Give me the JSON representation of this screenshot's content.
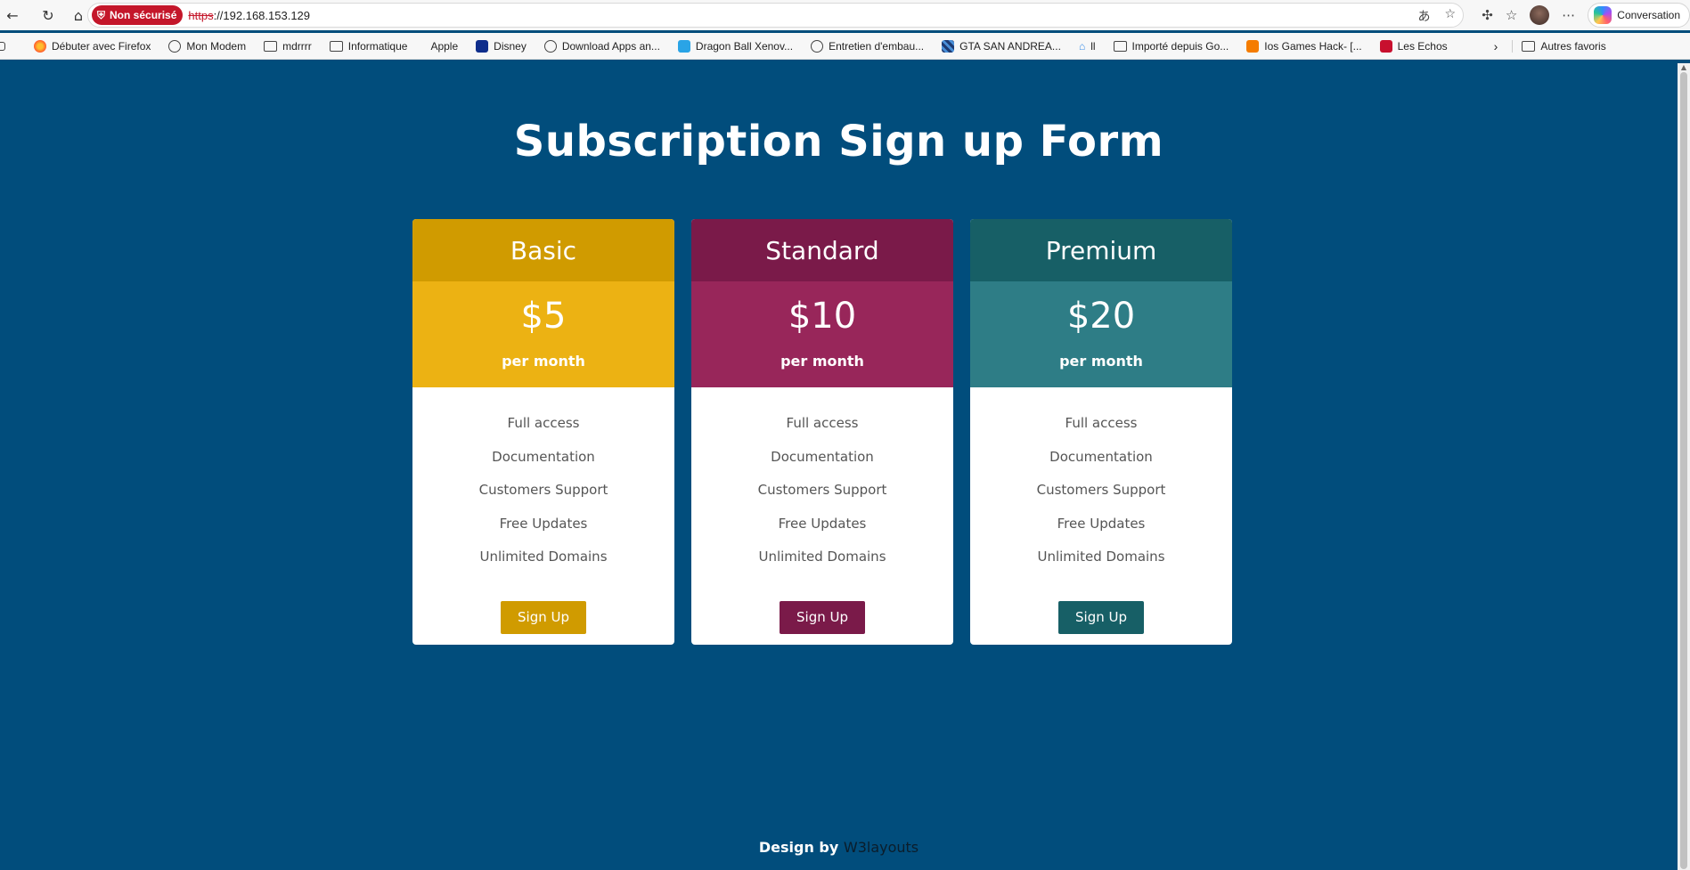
{
  "browser": {
    "security_label": "Non sécurisé",
    "url_scheme": "https",
    "url_rest": "://192.168.153.129",
    "conversation_label": "Conversation",
    "bookmarks": [
      {
        "label": "Débuter avec Firefox",
        "icon": "firefox-icon"
      },
      {
        "label": "Mon Modem",
        "icon": "globe-icon"
      },
      {
        "label": "mdrrrr",
        "icon": "folder-icon"
      },
      {
        "label": "Informatique",
        "icon": "folder-icon"
      },
      {
        "label": "Apple",
        "icon": "apple-icon"
      },
      {
        "label": "Disney",
        "icon": "disney-icon"
      },
      {
        "label": "Download Apps an...",
        "icon": "globe-icon"
      },
      {
        "label": "Dragon Ball Xenov...",
        "icon": "store-icon"
      },
      {
        "label": "Entretien d'embau...",
        "icon": "globe-icon"
      },
      {
        "label": "GTA SAN ANDREA...",
        "icon": "gta-icon"
      },
      {
        "label": "ll",
        "icon": "bookmark-icon"
      },
      {
        "label": "Importé depuis Go...",
        "icon": "folder-icon"
      },
      {
        "label": "Ios Games Hack- [...",
        "icon": "blogger-icon"
      },
      {
        "label": "Les Echos",
        "icon": "echos-icon"
      }
    ],
    "other_favorites": "Autres favoris"
  },
  "page": {
    "title": "Subscription Sign up Form",
    "plans": [
      {
        "name": "Basic",
        "price": "$5",
        "period": "per month",
        "features": [
          "Full access",
          "Documentation",
          "Customers Support",
          "Free Updates",
          "Unlimited Domains"
        ],
        "button": "Sign Up"
      },
      {
        "name": "Standard",
        "price": "$10",
        "period": "per month",
        "features": [
          "Full access",
          "Documentation",
          "Customers Support",
          "Free Updates",
          "Unlimited Domains"
        ],
        "button": "Sign Up"
      },
      {
        "name": "Premium",
        "price": "$20",
        "period": "per month",
        "features": [
          "Full access",
          "Documentation",
          "Customers Support",
          "Free Updates",
          "Unlimited Domains"
        ],
        "button": "Sign Up"
      }
    ],
    "footer_prefix": "Design by",
    "footer_link": "W3layouts"
  },
  "colors": {
    "page_background": "#014d7c",
    "basic": "#d09b00",
    "standard": "#7a1a49",
    "premium": "#175f66"
  }
}
